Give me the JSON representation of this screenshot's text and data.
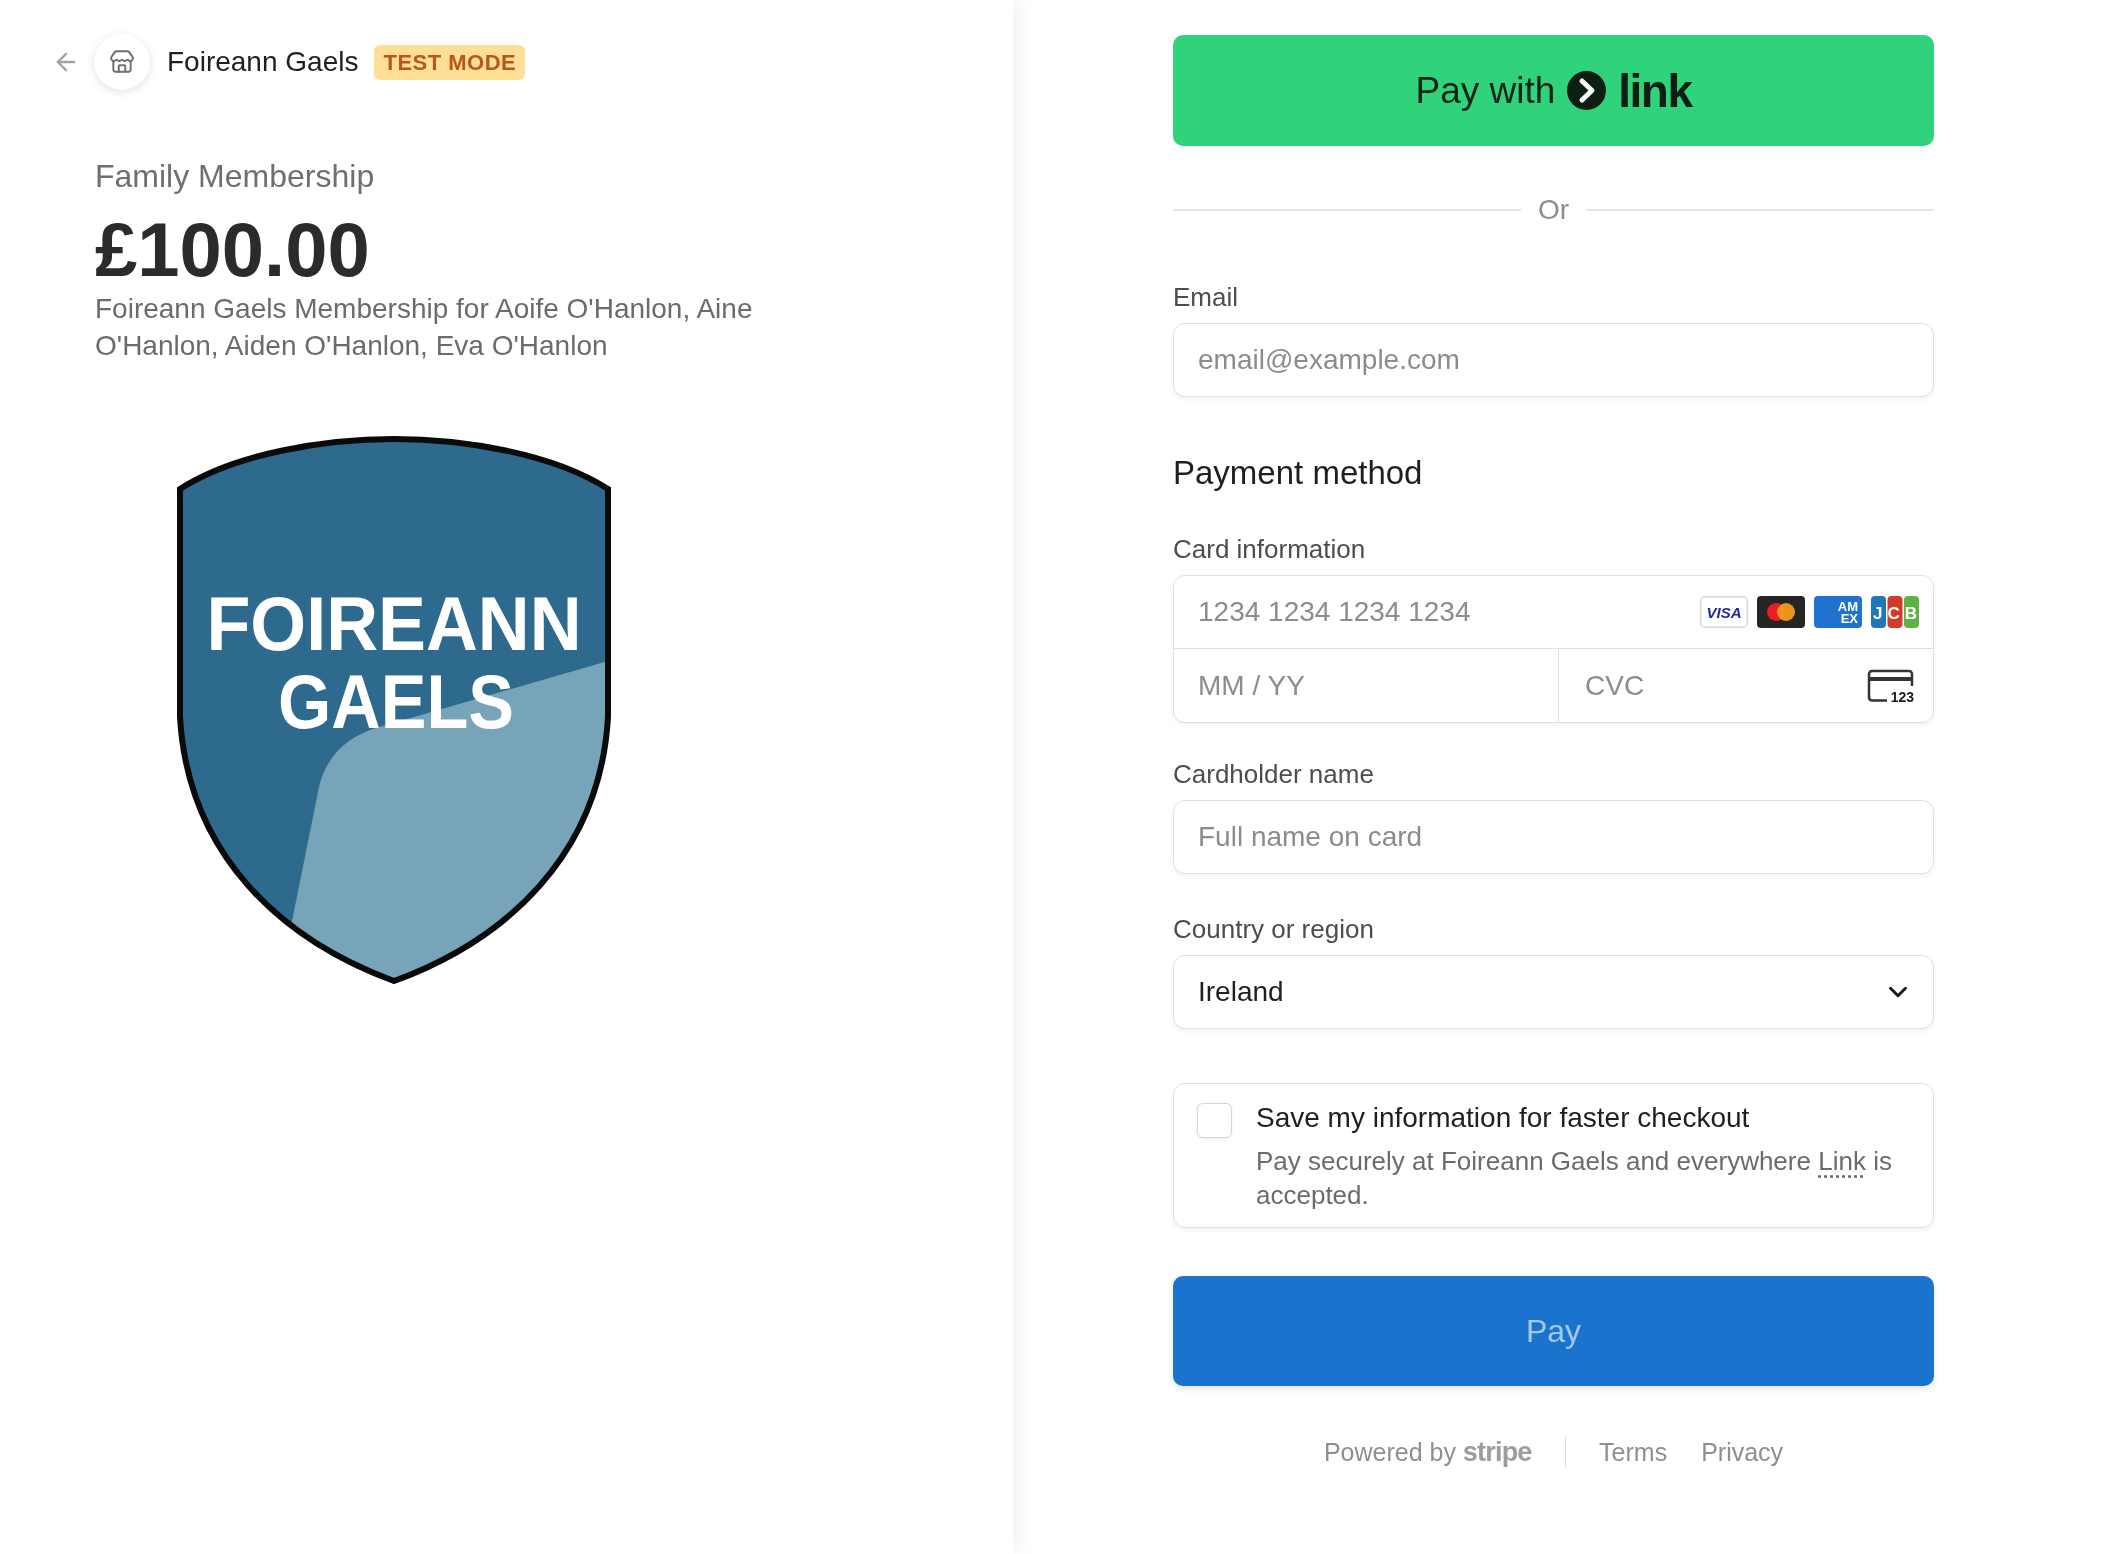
{
  "header": {
    "business_name": "Foireann Gaels",
    "badge": "TEST MODE"
  },
  "product": {
    "name": "Family Membership",
    "price": "£100.00",
    "description": "Foireann Gaels Membership for Aoife O'Hanlon, Aine O'Hanlon, Aiden O'Hanlon, Eva O'Hanlon",
    "logo": {
      "lines": [
        "FOIREANN",
        "GAELS"
      ]
    }
  },
  "express_checkout": {
    "label": "Pay with",
    "brand": "link",
    "divider": "Or"
  },
  "email": {
    "label": "Email",
    "placeholder": "email@example.com"
  },
  "payment_method": {
    "title": "Payment method",
    "card_information": {
      "label": "Card information",
      "number_placeholder": "1234 1234 1234 1234",
      "brands": [
        {
          "kind": "visa",
          "lines": [
            "VISA"
          ]
        },
        {
          "kind": "mastercard"
        },
        {
          "kind": "amex",
          "lines": [
            "AM",
            "EX"
          ]
        },
        {
          "kind": "jcb",
          "lines": [
            "JCB"
          ]
        }
      ],
      "expiry_placeholder": "MM / YY",
      "cvc_placeholder": "CVC",
      "cvc_icon_text": "123"
    },
    "cardholder_name": {
      "label": "Cardholder name",
      "placeholder": "Full name on card"
    },
    "country": {
      "label": "Country or region",
      "value": "Ireland"
    }
  },
  "save_info": {
    "checked": false,
    "title": "Save my information for faster checkout",
    "description": {
      "before": "Pay securely at Foireann Gaels and everywhere",
      "link": "Link",
      "after": "is accepted."
    }
  },
  "pay_button": {
    "label": "Pay",
    "disabled": true
  },
  "footer": {
    "powered_by": "Powered by",
    "brand": "stripe",
    "links": [
      "Terms",
      "Privacy"
    ]
  }
}
